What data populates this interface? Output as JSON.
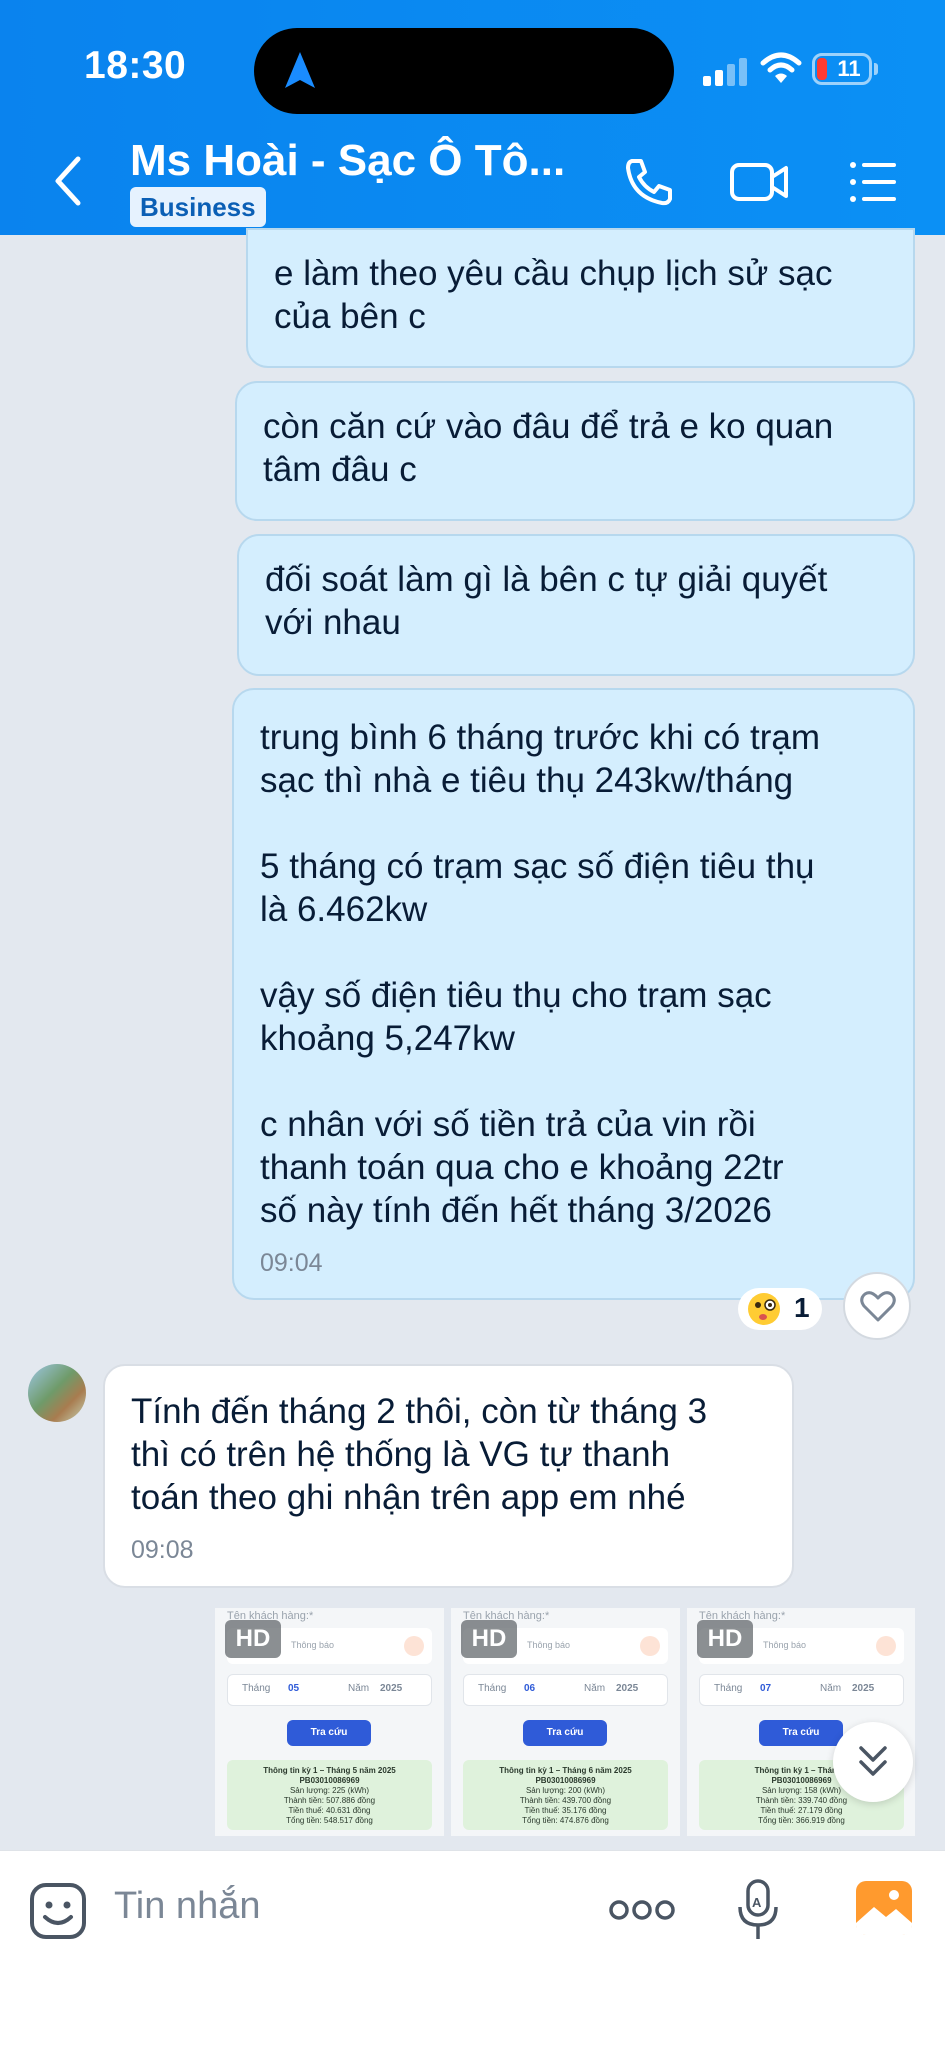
{
  "status_bar": {
    "time": "18:30",
    "battery": "11"
  },
  "header": {
    "title": "Ms Hoài - Sạc Ô Tô...",
    "badge": "Business"
  },
  "messages": [
    {
      "lines": [
        "e làm theo yêu cầu chụp lịch sử sạc",
        "của bên c"
      ]
    },
    {
      "lines": [
        "còn căn cứ vào đâu để trả e ko quan",
        "tâm đâu c"
      ]
    },
    {
      "lines": [
        "đối soát làm gì là bên c tự giải quyết",
        "với nhau"
      ]
    },
    {
      "paragraphs": [
        [
          "trung bình 6 tháng trước khi có trạm",
          "sạc thì nhà e tiêu thụ 243kw/tháng"
        ],
        [
          "5 tháng có trạm sạc số điện tiêu thụ",
          "là 6.462kw"
        ],
        [
          "vậy số điện tiêu thụ cho trạm sạc",
          "khoảng 5,247kw"
        ],
        [
          "c nhân với số tiền trả của vin rồi",
          "thanh toán qua cho e khoảng 22tr",
          "số này tính đến hết tháng 3/2026"
        ]
      ],
      "time": "09:04",
      "reaction_count": "1"
    },
    {
      "lines": [
        "Tính đến tháng 2 thôi, còn từ tháng 3",
        "thì có trên hệ thống là VG tự thanh",
        "toán theo ghi nhận trên app em nhé"
      ],
      "time": "09:08"
    }
  ],
  "thumbnails": [
    {
      "hd": "HD",
      "top": "Tên khách hàng:*",
      "select": "Thông báo",
      "thang_label": "Tháng",
      "thang": "05",
      "nam_label": "Năm",
      "nam": "2025",
      "button": "Tra cứu",
      "card_title": "Thông tin kỳ 1 – Tháng 5 năm 2025",
      "card_id": "PB03010086969",
      "card_l1": "Sản lượng: 225 (kWh)",
      "card_l2": "Thành tiền: 507.886 đồng",
      "card_l3": "Tiền thuế: 40.631 đồng",
      "card_l4": "Tổng tiền: 548.517 đồng"
    },
    {
      "hd": "HD",
      "top": "Tên khách hàng:*",
      "select": "Thông báo",
      "thang_label": "Tháng",
      "thang": "06",
      "nam_label": "Năm",
      "nam": "2025",
      "button": "Tra cứu",
      "card_title": "Thông tin kỳ 1 – Tháng 6 năm 2025",
      "card_id": "PB03010086969",
      "card_l1": "Sản lượng: 200 (kWh)",
      "card_l2": "Thành tiền: 439.700 đồng",
      "card_l3": "Tiền thuế: 35.176 đồng",
      "card_l4": "Tổng tiền: 474.876 đồng"
    },
    {
      "hd": "HD",
      "top": "Tên khách hàng:*",
      "select": "Thông báo",
      "thang_label": "Tháng",
      "thang": "07",
      "nam_label": "Năm",
      "nam": "2025",
      "button": "Tra cứu",
      "card_title": "Thông tin kỳ 1 – Tháng 7",
      "card_id": "PB03010086969",
      "card_l1": "Sản lượng: 158 (kWh)",
      "card_l2": "Thành tiền: 339.740 đồng",
      "card_l3": "Tiền thuế: 27.179 đồng",
      "card_l4": "Tổng tiền: 366.919 đồng"
    }
  ],
  "input": {
    "placeholder": "Tin nhắn"
  },
  "icons": {
    "accent": "#0a83ee",
    "bubble_out": "#d4eefe",
    "bubble_in": "#ffffff"
  }
}
